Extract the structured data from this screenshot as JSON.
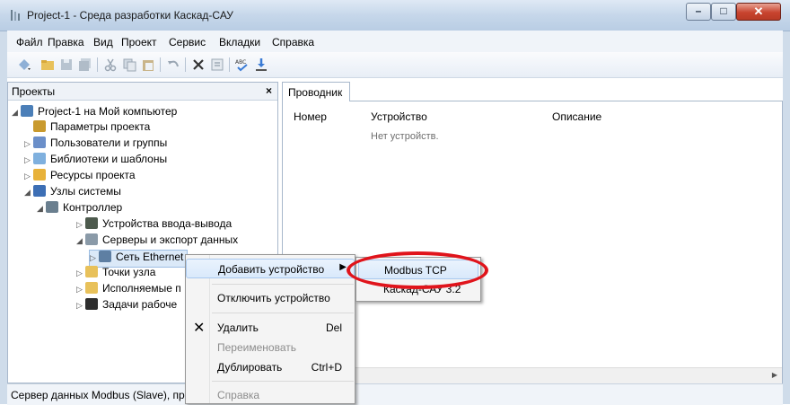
{
  "window": {
    "title": "Project-1 - Среда разработки Каскад-САУ",
    "controls": {
      "minimize": "–",
      "maximize": "□",
      "close": "✕"
    }
  },
  "menu": [
    "Файл",
    "Правка",
    "Вид",
    "Проект",
    "Сервис",
    "Вкладки",
    "Справка"
  ],
  "toolbar_icons": [
    "new-icon",
    "open-folder-icon",
    "save-icon",
    "save-all-icon",
    "cut-icon",
    "copy-icon",
    "paste-icon",
    "undo-icon",
    "delete-icon",
    "properties-icon",
    "spellcheck-icon",
    "download-icon"
  ],
  "left_panel": {
    "title": "Проекты",
    "close": "×",
    "tree": [
      {
        "label": "Project-1 на Мой компьютер",
        "arrow": "◢",
        "icon_color": "#4b7fb8"
      },
      {
        "label": "Параметры проекта",
        "arrow": "",
        "icon_color": "#c99a2e"
      },
      {
        "label": "Пользователи и группы",
        "arrow": "▷",
        "icon_color": "#6b8fc9"
      },
      {
        "label": "Библиотеки и шаблоны",
        "arrow": "▷",
        "icon_color": "#7fb0de"
      },
      {
        "label": "Ресурсы проекта",
        "arrow": "▷",
        "icon_color": "#e8b23a"
      },
      {
        "label": "Узлы системы",
        "arrow": "◢",
        "icon_color": "#3d6fb5"
      },
      {
        "label": "Контроллер",
        "arrow": "◢",
        "icon_color": "#6a7f8f"
      },
      {
        "label": "Устройства ввода-вывода",
        "arrow": "▷",
        "icon_color": "#4d5a4d"
      },
      {
        "label": "Серверы и экспорт данных",
        "arrow": "◢",
        "icon_color": "#8a9aa8"
      },
      {
        "label": "Сеть Ethernet",
        "arrow": "▷",
        "icon_color": "#5e7fa3"
      },
      {
        "label": "Точки узла",
        "arrow": "▷",
        "icon_color": "#e8c15a"
      },
      {
        "label": "Исполняемые п",
        "arrow": "▷",
        "icon_color": "#e8c15a"
      },
      {
        "label": "Задачи рабоче",
        "arrow": "▷",
        "icon_color": "#2e2e2e"
      }
    ]
  },
  "right_panel": {
    "tab": "Проводник",
    "columns": [
      "Номер",
      "Устройство",
      "Описание"
    ],
    "empty_text": "Нет устройств."
  },
  "context_menu": {
    "items": [
      {
        "label": "Добавить устройство",
        "shortcut": "",
        "submenu_arrow": "▶",
        "disabled": false
      },
      {
        "label": "Отключить устройство",
        "shortcut": "",
        "disabled": false
      },
      {
        "label": "Удалить",
        "shortcut": "Del",
        "icon": "✕",
        "disabled": false
      },
      {
        "label": "Переименовать",
        "shortcut": "",
        "disabled": true
      },
      {
        "label": "Дублировать",
        "shortcut": "Ctrl+D",
        "disabled": false
      },
      {
        "label": "Справка",
        "shortcut": "",
        "disabled": true
      }
    ]
  },
  "submenu": {
    "items": [
      "Modbus TCP",
      "Каскад-САУ 3.2"
    ]
  },
  "status_bar": {
    "text": "Сервер данных Modbus (Slave), пр"
  },
  "colors": {
    "title_gradient": "#c6d7ea",
    "highlight": "#d9e9fb",
    "annotation_ring": "#e0141b"
  }
}
